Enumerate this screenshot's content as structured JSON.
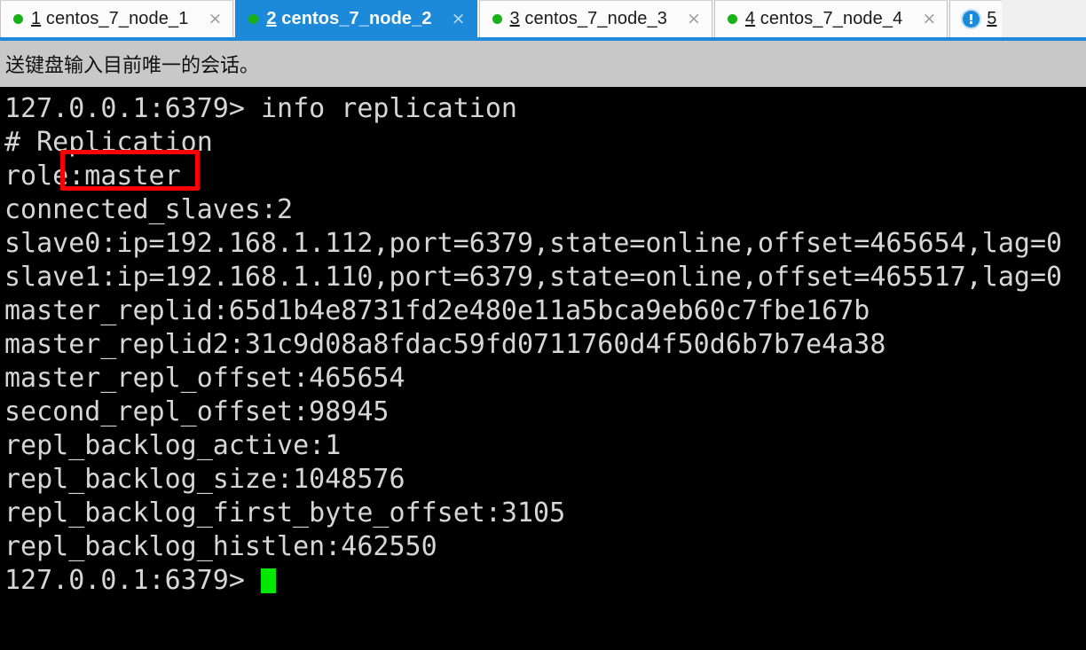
{
  "window": {
    "app_kind": "ssh-terminal-client"
  },
  "tab_bar": {
    "tabs": [
      {
        "index": "1",
        "label": " centos_7_node_1",
        "active": false,
        "status_icon": "green-dot",
        "close_label": "×"
      },
      {
        "index": "2",
        "label": " centos_7_node_2",
        "active": true,
        "status_icon": "green-dot",
        "close_label": "×"
      },
      {
        "index": "3",
        "label": " centos_7_node_3",
        "active": false,
        "status_icon": "green-dot",
        "close_label": "×"
      },
      {
        "index": "4",
        "label": " centos_7_node_4",
        "active": false,
        "status_icon": "green-dot",
        "close_label": "×"
      },
      {
        "index": "5",
        "label": "",
        "active": false,
        "status_icon": "blue-alert",
        "close_label": ""
      }
    ],
    "active_tab_color": "#1c8ad8",
    "status_dot_color": "#18b218"
  },
  "notice_bar": {
    "text": "送键盘输入目前唯一的会话。",
    "background": "#c8c8c8"
  },
  "terminal": {
    "background": "#000000",
    "foreground": "#d6d6d6",
    "cursor_color": "#00e800",
    "prompt": "127.0.0.1:6379>",
    "command": "info replication",
    "lines": [
      "127.0.0.1:6379> info replication",
      "# Replication",
      "role:master",
      "connected_slaves:2",
      "slave0:ip=192.168.1.112,port=6379,state=online,offset=465654,lag=0",
      "slave1:ip=192.168.1.110,port=6379,state=online,offset=465517,lag=0",
      "master_replid:65d1b4e8731fd2e480e11a5bca9eb60c7fbe167b",
      "master_replid2:31c9d08a8fdac59fd0711760d4f50d6b7b7e4a38",
      "master_repl_offset:465654",
      "second_repl_offset:98945",
      "repl_backlog_active:1",
      "repl_backlog_size:1048576",
      "repl_backlog_first_byte_offset:3105",
      "repl_backlog_histlen:462550"
    ],
    "last_prompt": "127.0.0.1:6379> "
  },
  "annotation": {
    "highlighted_text": ":master",
    "color": "#fb0000",
    "shape": "rectangle"
  }
}
